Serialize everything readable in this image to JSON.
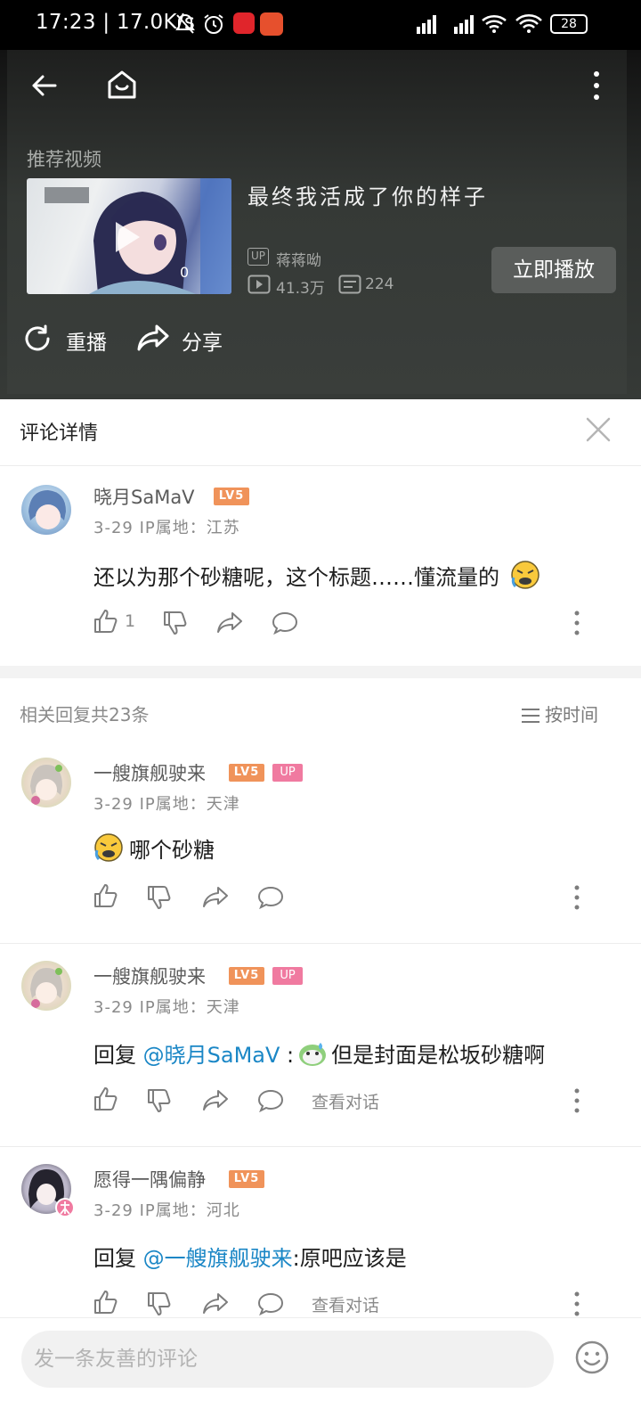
{
  "status_bar": {
    "time": "17:23 | 17.0K/s",
    "battery": "28"
  },
  "video": {
    "recommend_label": "推荐视频",
    "title": "最终我活成了你的样子",
    "up_badge": "UP",
    "uploader": "蒋蒋呦",
    "views": "41.3万",
    "danmaku": "224",
    "thumb_counter": "0",
    "play_now": "立即播放",
    "replay": "重播",
    "share": "分享"
  },
  "sheet": {
    "title": "评论详情"
  },
  "root_comment": {
    "username": "晓月SaMaV",
    "level": "LV5",
    "meta": "3-29  IP属地：江苏",
    "text": "还以为那个砂糖呢，这个标题……懂流量的",
    "likes": "1"
  },
  "replies_header": {
    "count": "相关回复共23条",
    "sort": "按时间"
  },
  "replies": [
    {
      "username": "一艘旗舰驶来",
      "level": "LV5",
      "up": "UP",
      "meta": "3-29  IP属地：天津",
      "text": "哪个砂糖"
    },
    {
      "username": "一艘旗舰驶来",
      "level": "LV5",
      "up": "UP",
      "meta": "3-29  IP属地：天津",
      "reply_prefix": "回复 ",
      "mention": "@晓月SaMaV",
      "text_after": "但是封面是松坂砂糖啊",
      "view_dialog": "查看对话"
    },
    {
      "username": "愿得一隅偏静",
      "level": "LV5",
      "meta": "3-29  IP属地：河北",
      "reply_prefix": "回复 ",
      "mention": "@一艘旗舰驶来",
      "text_after": ":原吧应该是",
      "view_dialog": "查看对话"
    }
  ],
  "bottom": {
    "placeholder": "发一条友善的评论"
  },
  "colors": {
    "mention": "#1b87c6",
    "level_badge": "#f0935a",
    "up_badge": "#f07aa0"
  }
}
